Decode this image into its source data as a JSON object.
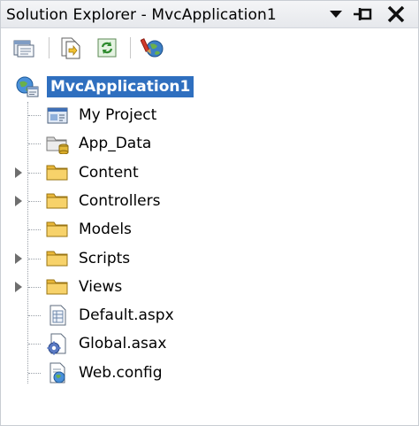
{
  "window": {
    "title": "Solution Explorer - MvcApplication1"
  },
  "titlebar_buttons": [
    {
      "name": "dropdown-icon"
    },
    {
      "name": "pin-icon"
    },
    {
      "name": "close-icon"
    }
  ],
  "toolbar": {
    "buttons": [
      {
        "name": "properties-icon"
      },
      {
        "name": "show-all-files-icon"
      },
      {
        "name": "refresh-icon"
      },
      {
        "name": "view-class-diagram-icon"
      }
    ]
  },
  "tree": {
    "root": {
      "label": "MvcApplication1",
      "icon": "web-project-icon",
      "selected": true
    },
    "items": [
      {
        "label": "My Project",
        "icon": "my-project-icon",
        "expandable": false
      },
      {
        "label": "App_Data",
        "icon": "special-folder-icon",
        "expandable": false
      },
      {
        "label": "Content",
        "icon": "folder-icon",
        "expandable": true
      },
      {
        "label": "Controllers",
        "icon": "folder-icon",
        "expandable": true
      },
      {
        "label": "Models",
        "icon": "folder-icon",
        "expandable": false
      },
      {
        "label": "Scripts",
        "icon": "folder-icon",
        "expandable": true
      },
      {
        "label": "Views",
        "icon": "folder-icon",
        "expandable": true
      },
      {
        "label": "Default.aspx",
        "icon": "aspx-file-icon",
        "expandable": false
      },
      {
        "label": "Global.asax",
        "icon": "asax-file-icon",
        "expandable": false
      },
      {
        "label": "Web.config",
        "icon": "config-file-icon",
        "expandable": false
      }
    ]
  },
  "colors": {
    "selection": "#2f6fbf",
    "folder": "#f5c94a"
  }
}
